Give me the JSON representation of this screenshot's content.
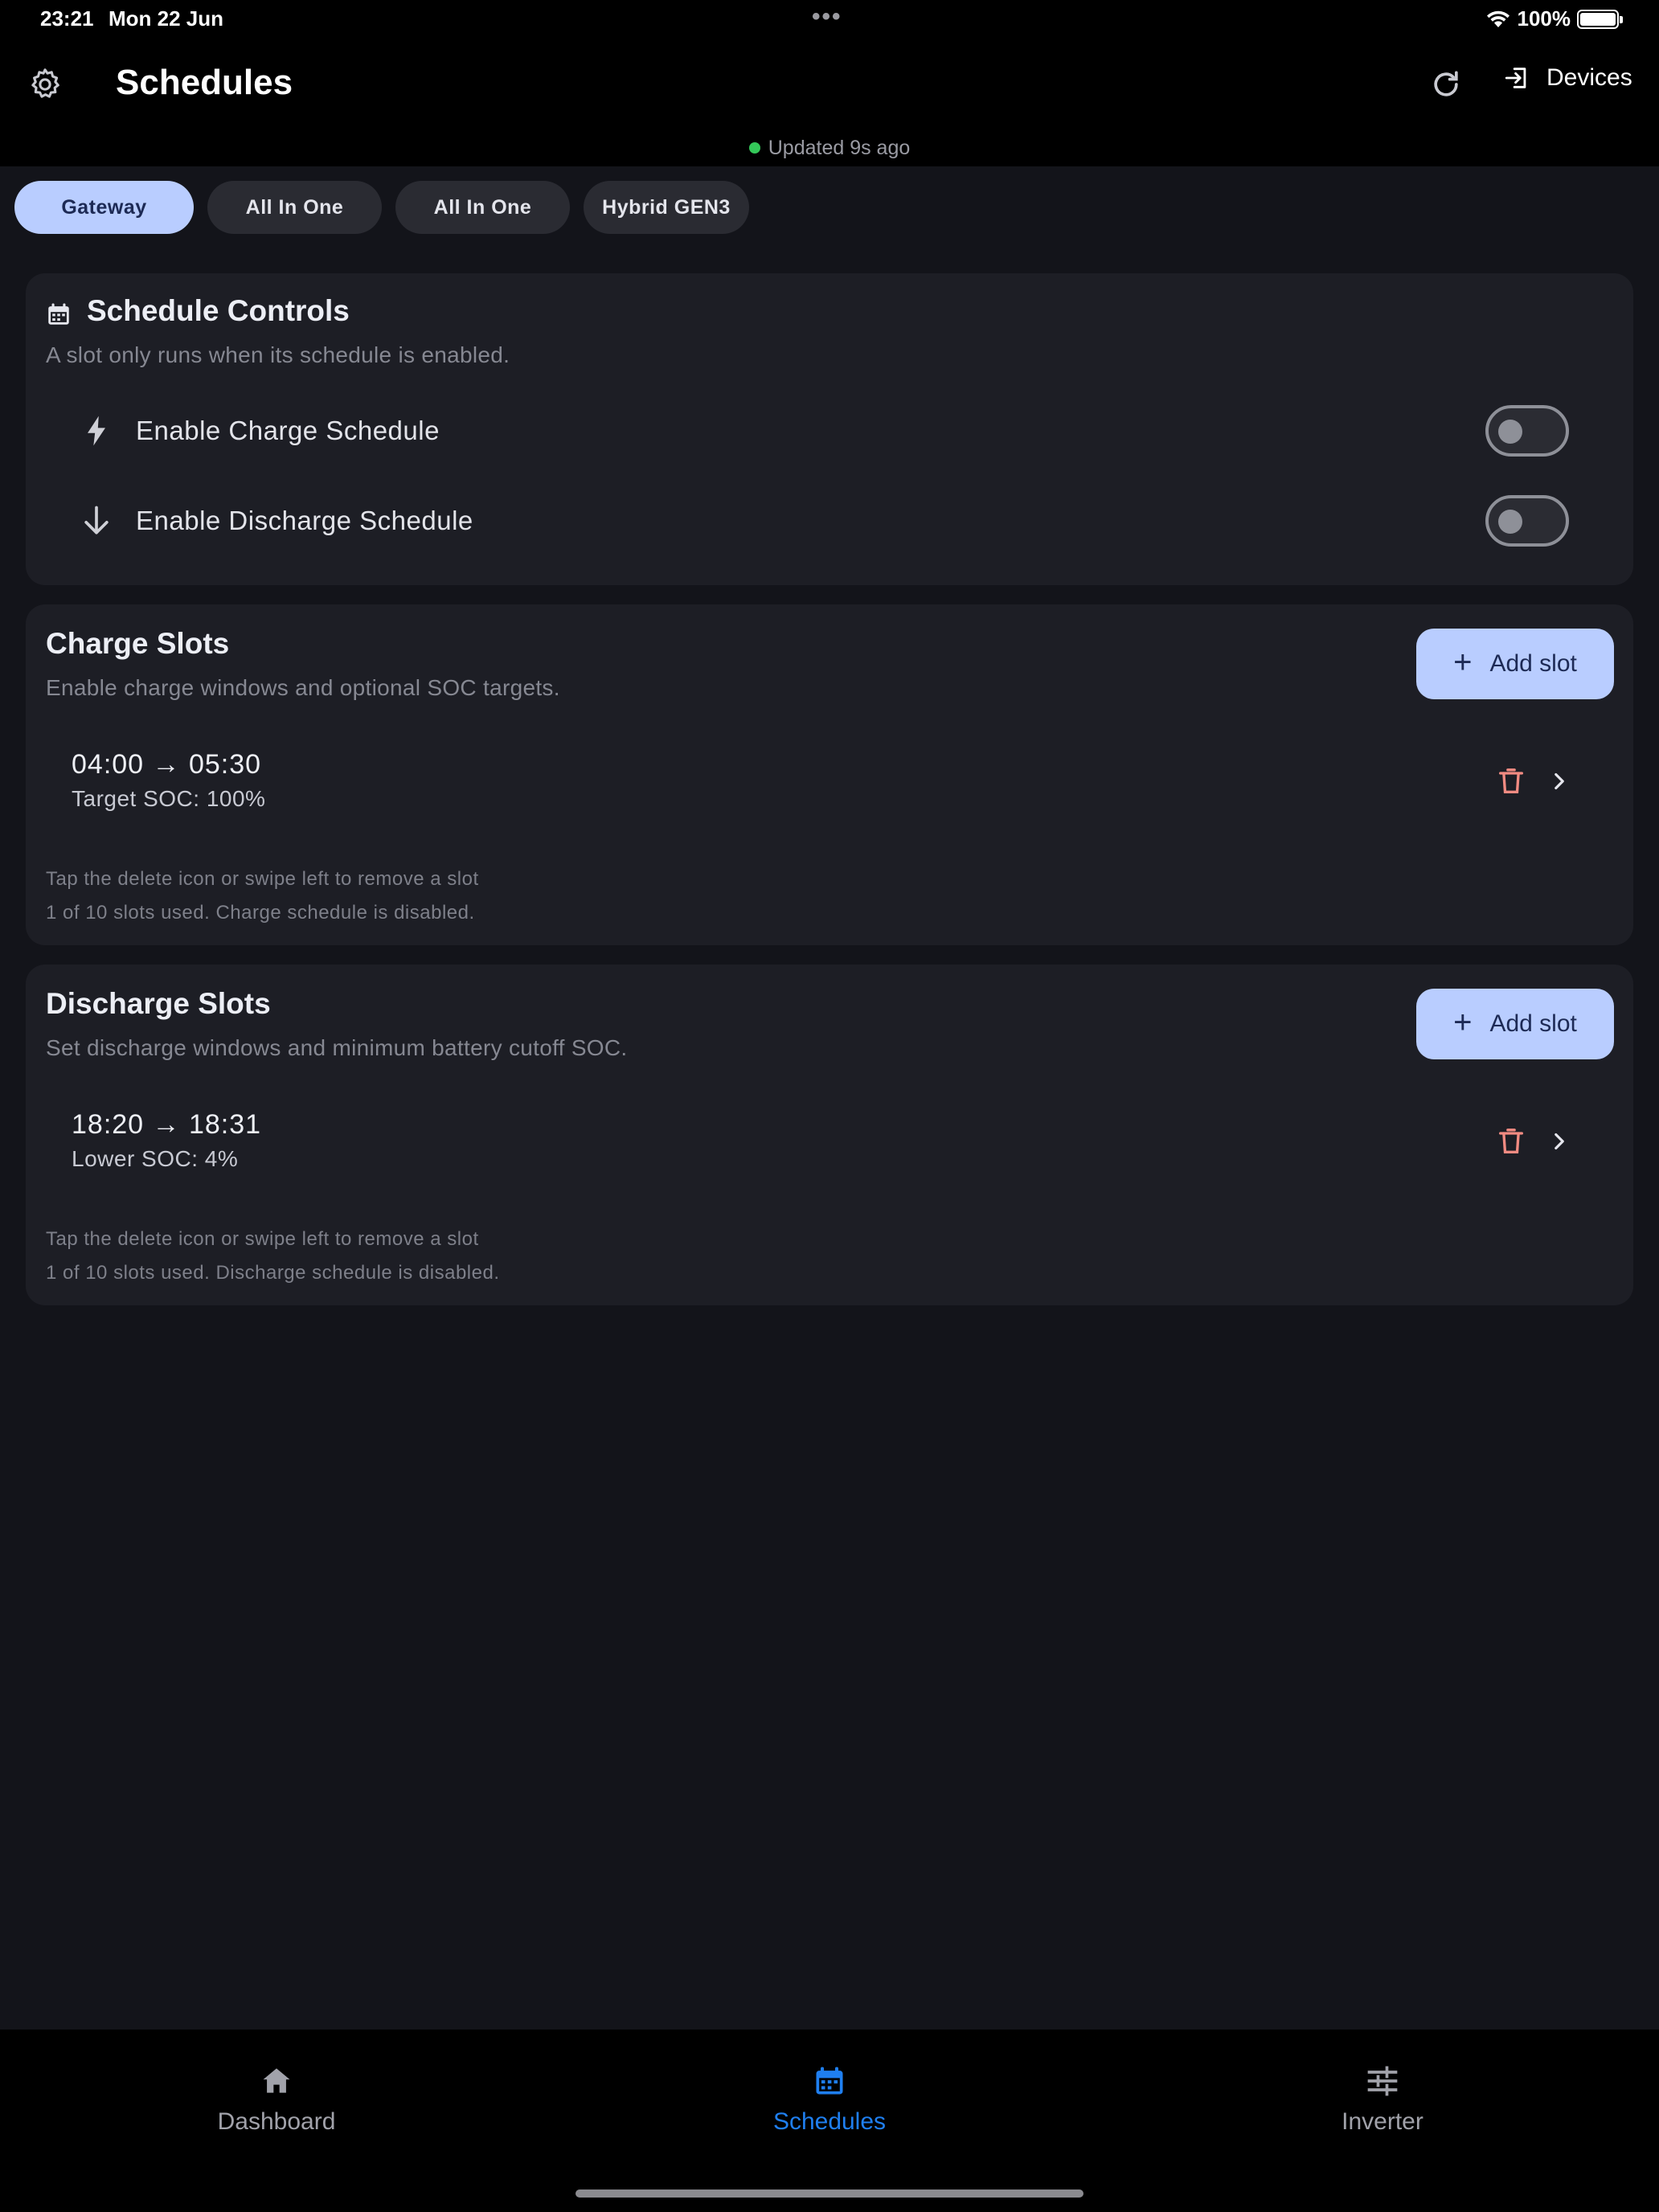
{
  "status_bar": {
    "time": "23:21",
    "date": "Mon 22 Jun",
    "battery_percent": "100%",
    "icons": [
      "wifi-icon",
      "battery-icon"
    ]
  },
  "header": {
    "title": "Schedules",
    "devices_label": "Devices",
    "updated_text": "Updated 9s ago",
    "icons": [
      "gear-icon",
      "refresh-icon",
      "login-icon"
    ]
  },
  "device_tabs": [
    {
      "label": "Gateway",
      "active": true
    },
    {
      "label": "All In One",
      "active": false
    },
    {
      "label": "All In One",
      "active": false
    },
    {
      "label": "Hybrid GEN3",
      "active": false
    }
  ],
  "schedule_controls": {
    "title": "Schedule Controls",
    "subtitle": "A slot only runs when its schedule is enabled.",
    "charge_label": "Enable Charge Schedule",
    "charge_enabled": false,
    "discharge_label": "Enable Discharge Schedule",
    "discharge_enabled": false
  },
  "charge_slots": {
    "title": "Charge Slots",
    "subtitle": "Enable charge windows and optional SOC targets.",
    "add_label": "Add slot",
    "slots": [
      {
        "time": "04:00 → 05:30",
        "detail": "Target SOC: 100%"
      }
    ],
    "hint": "Tap the delete icon or swipe left to remove a slot",
    "usage": "1 of 10 slots used. Charge schedule is disabled."
  },
  "discharge_slots": {
    "title": "Discharge Slots",
    "subtitle": "Set discharge windows and minimum battery cutoff SOC.",
    "add_label": "Add slot",
    "slots": [
      {
        "time": "18:20 → 18:31",
        "detail": "Lower SOC: 4%"
      }
    ],
    "hint": "Tap the delete icon or swipe left to remove a slot",
    "usage": "1 of 10 slots used. Discharge schedule is disabled."
  },
  "bottom_nav": [
    {
      "label": "Dashboard",
      "icon": "home-icon",
      "active": false
    },
    {
      "label": "Schedules",
      "icon": "calendar-icon",
      "active": true
    },
    {
      "label": "Inverter",
      "icon": "sliders-icon",
      "active": false
    }
  ],
  "colors": {
    "accent": "#b9cdff",
    "nav_active": "#1f7ff0",
    "delete": "#f28b82",
    "online_dot": "#34c759",
    "background": "#13141a",
    "card": "#1d1e25"
  }
}
